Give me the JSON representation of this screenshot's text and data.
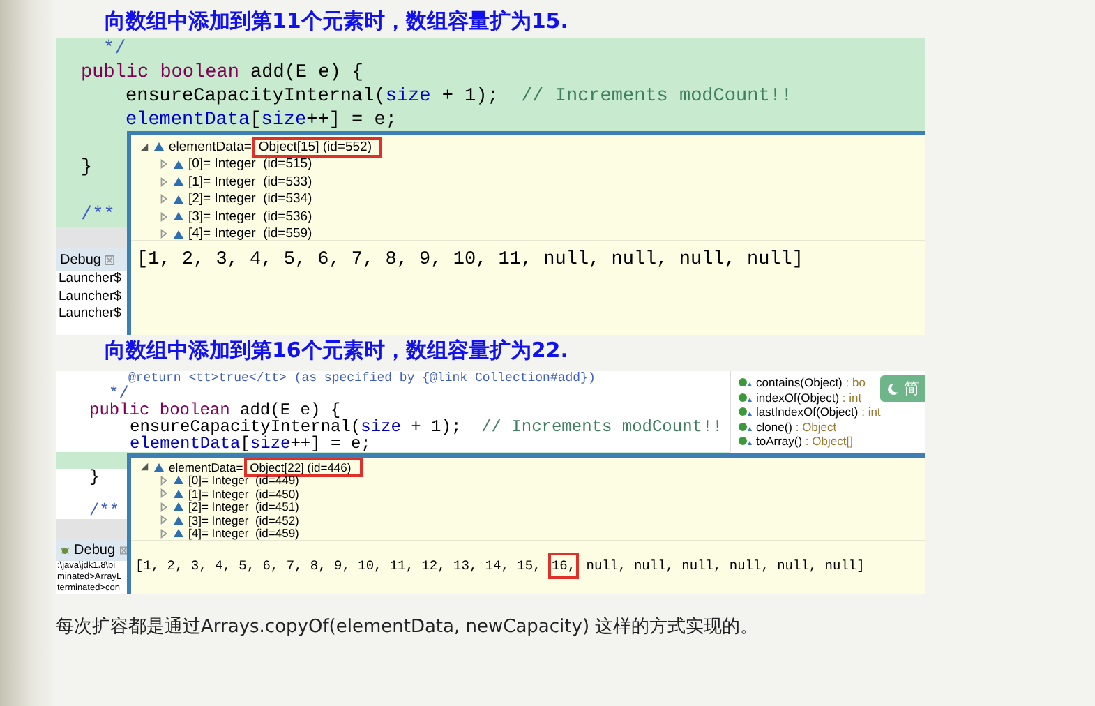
{
  "sections": [
    {
      "heading": "向数组中添加到第11个元素时，数组容量扩为15.",
      "screenshot": {
        "code_lines": [
          {
            "highlighted": true,
            "kind": "doc",
            "tokens": [
              {
                "text": "*/",
                "kind": "javadoc"
              }
            ]
          },
          {
            "highlighted": true,
            "kind": "top",
            "tokens": [
              {
                "text": "public boolean",
                "kind": "keyword"
              },
              {
                "text": " add(E e) {",
                "kind": "plain"
              }
            ]
          },
          {
            "highlighted": true,
            "kind": "statement",
            "tokens": [
              {
                "text": "ensureCapacityInternal(",
                "kind": "plain"
              },
              {
                "text": "size",
                "kind": "field"
              },
              {
                "text": " + 1);  ",
                "kind": "plain"
              },
              {
                "text": "// Increments modCount!!",
                "kind": "comment"
              }
            ]
          },
          {
            "highlighted": true,
            "kind": "statement",
            "tokens": [
              {
                "text": "elementData",
                "kind": "field"
              },
              {
                "text": "[",
                "kind": "plain"
              },
              {
                "text": "size",
                "kind": "field"
              },
              {
                "text": "++] = e;",
                "kind": "plain"
              }
            ]
          },
          {
            "highlighted": true,
            "kind": "top"
          },
          {
            "highlighted": true,
            "kind": "top",
            "tokens": [
              {
                "text": "}",
                "kind": "plain"
              }
            ]
          },
          {
            "highlighted": true,
            "kind": "top"
          },
          {
            "highlighted": true,
            "kind": "top",
            "tokens": [
              {
                "text": "/**",
                "kind": "javadoc"
              }
            ]
          }
        ],
        "debug_tab": "Debug",
        "debug_lines": [
          "Launcher$",
          "Launcher$",
          "Launcher$"
        ],
        "variable": {
          "name": "elementData=",
          "value": "Object[15]  (id=552)",
          "expanded": true
        },
        "entries": [
          {
            "label": "[0]= Integer",
            "id": "(id=515)"
          },
          {
            "label": "[1]= Integer",
            "id": "(id=533)"
          },
          {
            "label": "[2]= Integer",
            "id": "(id=534)"
          },
          {
            "label": "[3]= Integer",
            "id": "(id=536)"
          },
          {
            "label": "[4]= Integer",
            "id": "(id=559)"
          }
        ],
        "detail": [
          {
            "text": "[1, 2, 3, 4, 5, 6, 7, 8, 9, 10, 11, null, null, null, null]",
            "boxed": false
          }
        ]
      }
    },
    {
      "heading": "向数组中添加到第16个元素时，数组容量扩为22.",
      "screenshot": {
        "code_lines": [
          {
            "highlighted": false,
            "kind": "javadoc",
            "tokens": [
              {
                "text": "@return <tt>true</tt> (as specified by {@link Collection#add})",
                "kind": "javadoc"
              }
            ]
          },
          {
            "highlighted": false,
            "kind": "doc",
            "tokens": [
              {
                "text": "*/",
                "kind": "javadoc"
              }
            ]
          },
          {
            "highlighted": false,
            "kind": "top",
            "tokens": [
              {
                "text": "public boolean",
                "kind": "keyword"
              },
              {
                "text": " add(E e) {",
                "kind": "plain"
              }
            ]
          },
          {
            "highlighted": false,
            "kind": "statement",
            "tokens": [
              {
                "text": "ensureCapacityInternal(",
                "kind": "plain"
              },
              {
                "text": "size",
                "kind": "field"
              },
              {
                "text": " + 1);  ",
                "kind": "plain"
              },
              {
                "text": "// Increments modCount!!",
                "kind": "comment"
              }
            ]
          },
          {
            "highlighted": false,
            "kind": "statement",
            "tokens": [
              {
                "text": "elementData",
                "kind": "field"
              },
              {
                "text": "[",
                "kind": "plain"
              },
              {
                "text": "size",
                "kind": "field"
              },
              {
                "text": "++] = e;",
                "kind": "plain"
              }
            ]
          },
          {
            "highlighted": true,
            "kind": "top"
          },
          {
            "highlighted": false,
            "kind": "top",
            "tokens": [
              {
                "text": "}",
                "kind": "plain"
              }
            ]
          },
          {
            "highlighted": false,
            "kind": "top"
          },
          {
            "highlighted": false,
            "kind": "top",
            "tokens": [
              {
                "text": "/**",
                "kind": "javadoc"
              }
            ]
          }
        ],
        "outline": [
          {
            "name": "contains(Object)",
            "type": ": bo"
          },
          {
            "name": "indexOf(Object)",
            "type": ": int"
          },
          {
            "name": "lastIndexOf(Object)",
            "type": ": int"
          },
          {
            "name": "clone()",
            "type": ": Object"
          },
          {
            "name": "toArray()",
            "type": ": Object[]"
          }
        ],
        "badge": "简",
        "debug_tab": "Debug",
        "debug_lines": [
          ":\\java\\jdk1.8\\bi",
          "minated>ArrayL",
          "terminated>con"
        ],
        "variable": {
          "name": "elementData=",
          "value": "Object[22]  (id=446)",
          "expanded": true
        },
        "entries": [
          {
            "label": "[0]= Integer",
            "id": "(id=449)"
          },
          {
            "label": "[1]= Integer",
            "id": "(id=450)"
          },
          {
            "label": "[2]= Integer",
            "id": "(id=451)"
          },
          {
            "label": "[3]= Integer",
            "id": "(id=452)"
          },
          {
            "label": "[4]= Integer",
            "id": "(id=459)"
          }
        ],
        "detail": [
          {
            "text": "[1, 2, 3, 4, 5, 6, 7, 8, 9, 10, 11, 12, 13, 14, 15, ",
            "boxed": false
          },
          {
            "text": "16,",
            "boxed": true
          },
          {
            "text": " null, null, null, null, null, null]",
            "boxed": false
          }
        ]
      }
    }
  ],
  "footer": "每次扩容都是通过Arrays.copyOf(elementData, newCapacity) 这样的方式实现的。"
}
